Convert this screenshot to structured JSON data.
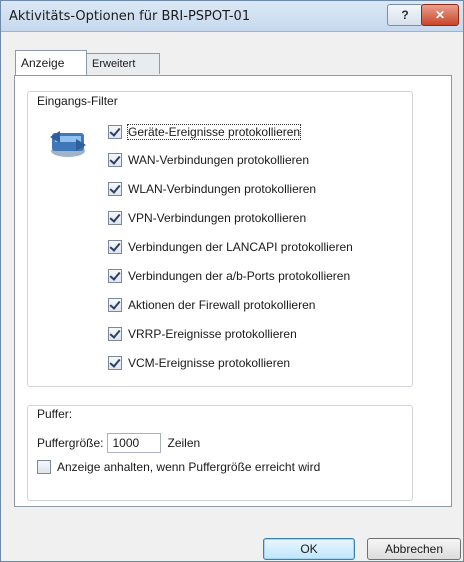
{
  "window": {
    "title": "Aktivitäts-Optionen für BRI-PSPOT-01"
  },
  "titlebar_buttons": {
    "help": "?",
    "close": "✕"
  },
  "tabs": [
    {
      "label": "Anzeige",
      "active": true
    },
    {
      "label": "Erweitert",
      "active": false
    }
  ],
  "input_filter": {
    "legend": "Eingangs-Filter",
    "icon": "network-filter-icon",
    "options": [
      {
        "label": "Geräte-Ereignisse protokollieren",
        "checked": true
      },
      {
        "label": "WAN-Verbindungen protokollieren",
        "checked": true
      },
      {
        "label": "WLAN-Verbindungen protokollieren",
        "checked": true
      },
      {
        "label": "VPN-Verbindungen protokollieren",
        "checked": true
      },
      {
        "label": "Verbindungen der LANCAPI protokollieren",
        "checked": true
      },
      {
        "label": "Verbindungen der a/b-Ports protokollieren",
        "checked": true
      },
      {
        "label": "Aktionen der Firewall protokollieren",
        "checked": true
      },
      {
        "label": "VRRP-Ereignisse protokollieren",
        "checked": true
      },
      {
        "label": "VCM-Ereignisse protokollieren",
        "checked": true
      }
    ]
  },
  "buffer": {
    "legend": "Puffer:",
    "size_label": "Puffergröße:",
    "size_value": "1000",
    "unit": "Zeilen",
    "pause_label": "Anzeige anhalten, wenn Puffergröße erreicht wird",
    "pause_checked": false
  },
  "buttons": {
    "ok": "OK",
    "cancel": "Abbrechen"
  },
  "colors": {
    "title_bar": "#c6d9ee",
    "close_button": "#c9452b",
    "ok_focus": "#3c7fb1"
  }
}
